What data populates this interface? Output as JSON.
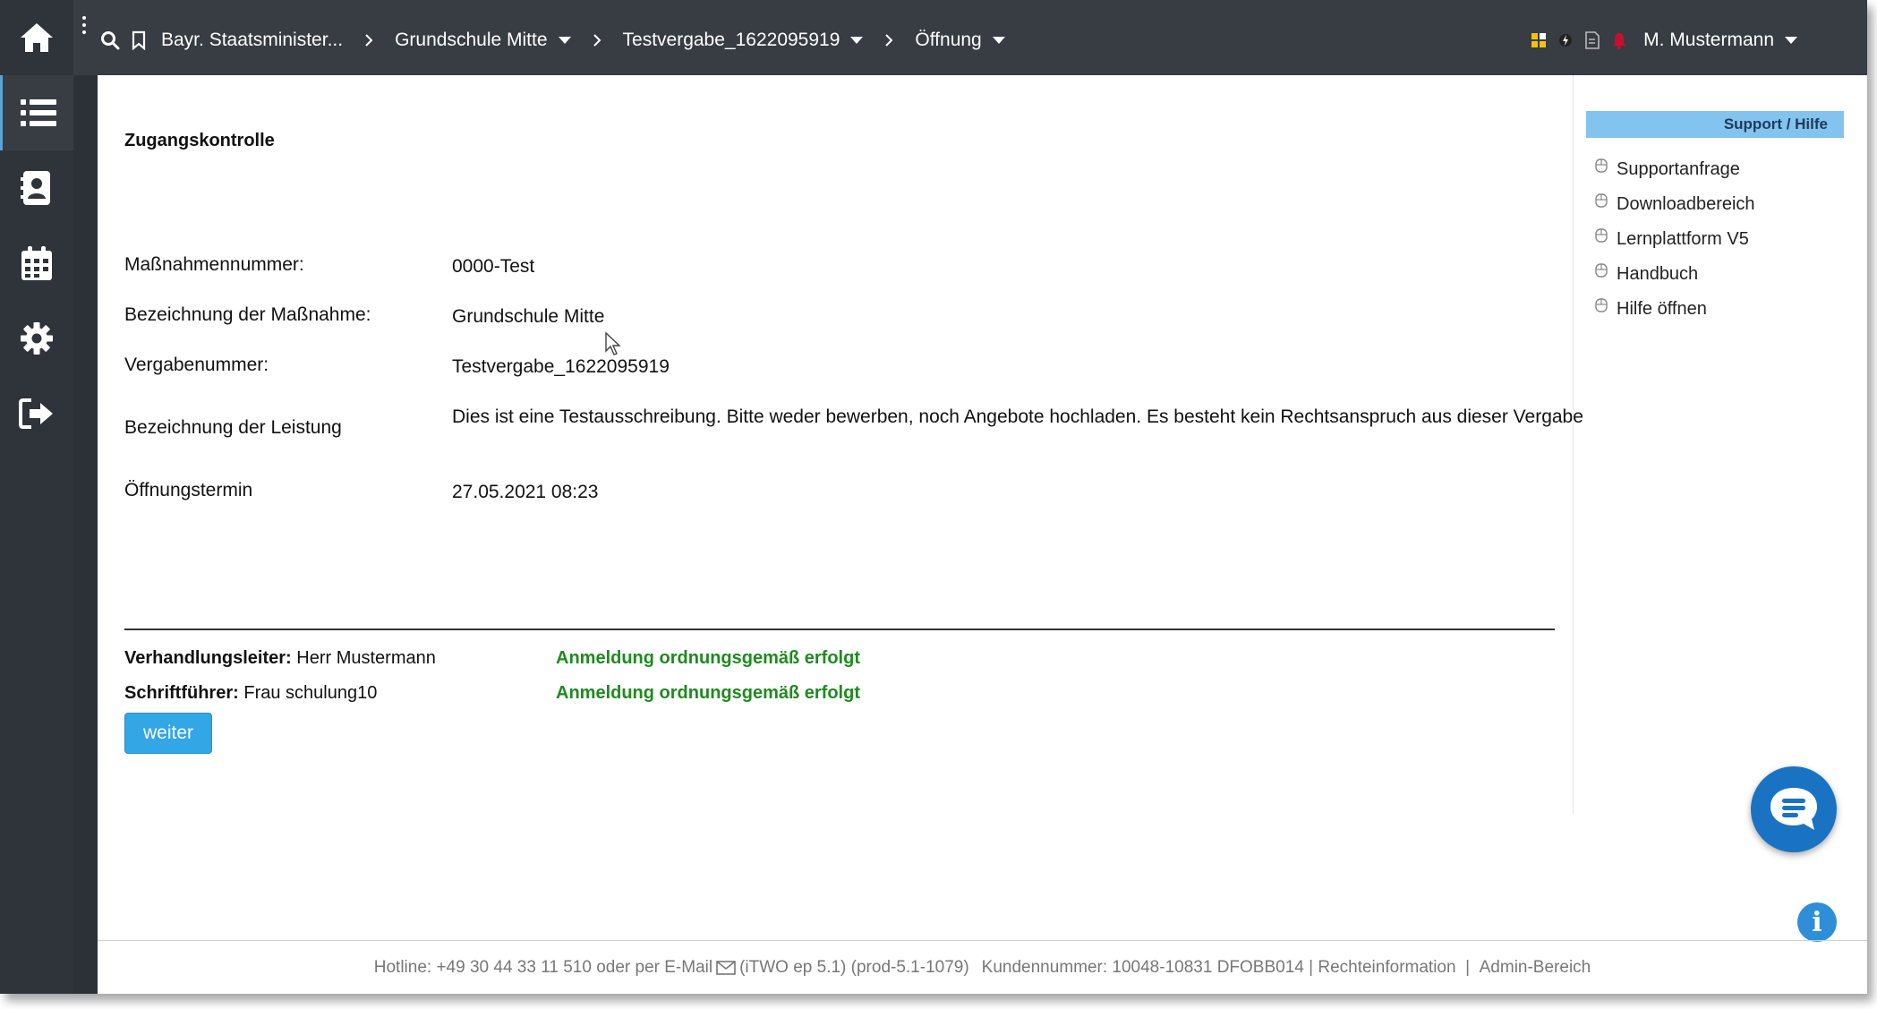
{
  "topbar": {
    "breadcrumbs": [
      {
        "label": "Bayr. Staatsminister...",
        "dropdown": false
      },
      {
        "label": "Grundschule Mitte",
        "dropdown": true
      },
      {
        "label": "Testvergabe_1622095919",
        "dropdown": true
      },
      {
        "label": "Öffnung",
        "dropdown": true
      }
    ],
    "user_name": "M. Mustermann"
  },
  "sidebar": {
    "items": [
      {
        "icon": "list-icon",
        "active": true
      },
      {
        "icon": "contact-book-icon",
        "active": false
      },
      {
        "icon": "calendar-icon",
        "active": false
      },
      {
        "icon": "gear-icon",
        "active": false
      },
      {
        "icon": "sign-out-icon",
        "active": false
      }
    ]
  },
  "main": {
    "title": "Zugangskontrolle",
    "fields": [
      {
        "label": "Maßnahmennummer:",
        "value": "0000-Test"
      },
      {
        "label": "Bezeichnung der Maßnahme:",
        "value": "Grundschule Mitte"
      },
      {
        "label": "Vergabenummer:",
        "value": "Testvergabe_1622095919"
      },
      {
        "label": "Bezeichnung der Leistung",
        "value": "Dies ist eine Testausschreibung. Bitte weder bewerben, noch Angebote hochladen. Es besteht kein Rechtsanspruch aus dieser Vergabe"
      },
      {
        "label": "Öffnungstermin",
        "value": "27.05.2021 08:23"
      }
    ],
    "persons": [
      {
        "role": "Verhandlungsleiter:",
        "name": " Herr Mustermann",
        "status": "Anmeldung ordnungsgemäß erfolgt"
      },
      {
        "role": "Schriftführer:",
        "name": " Frau schulung10",
        "status": "Anmeldung ordnungsgemäß erfolgt"
      }
    ],
    "next_button": "weiter"
  },
  "support": {
    "heading": "Support / Hilfe",
    "items": [
      "Supportanfrage",
      "Downloadbereich",
      "Lernplattform V5",
      "Handbuch",
      "Hilfe öffnen"
    ]
  },
  "footer": {
    "hotline": "Hotline: +49 30 44 33 11 510 oder per E-Mail",
    "version": "(iTWO ep 5.1) (prod-5.1-1079)",
    "customer": "Kundennummer: 10048-10831 DFOBB014",
    "legal": "Rechteinformation",
    "admin": "Admin-Bereich"
  },
  "colors": {
    "topbar": "#373d42",
    "sidebar": "#2e3439",
    "accent": "#33a6e5",
    "status_ok": "#1e8b1e",
    "support_head": "#82c3ef",
    "chat": "#1a73c2"
  }
}
